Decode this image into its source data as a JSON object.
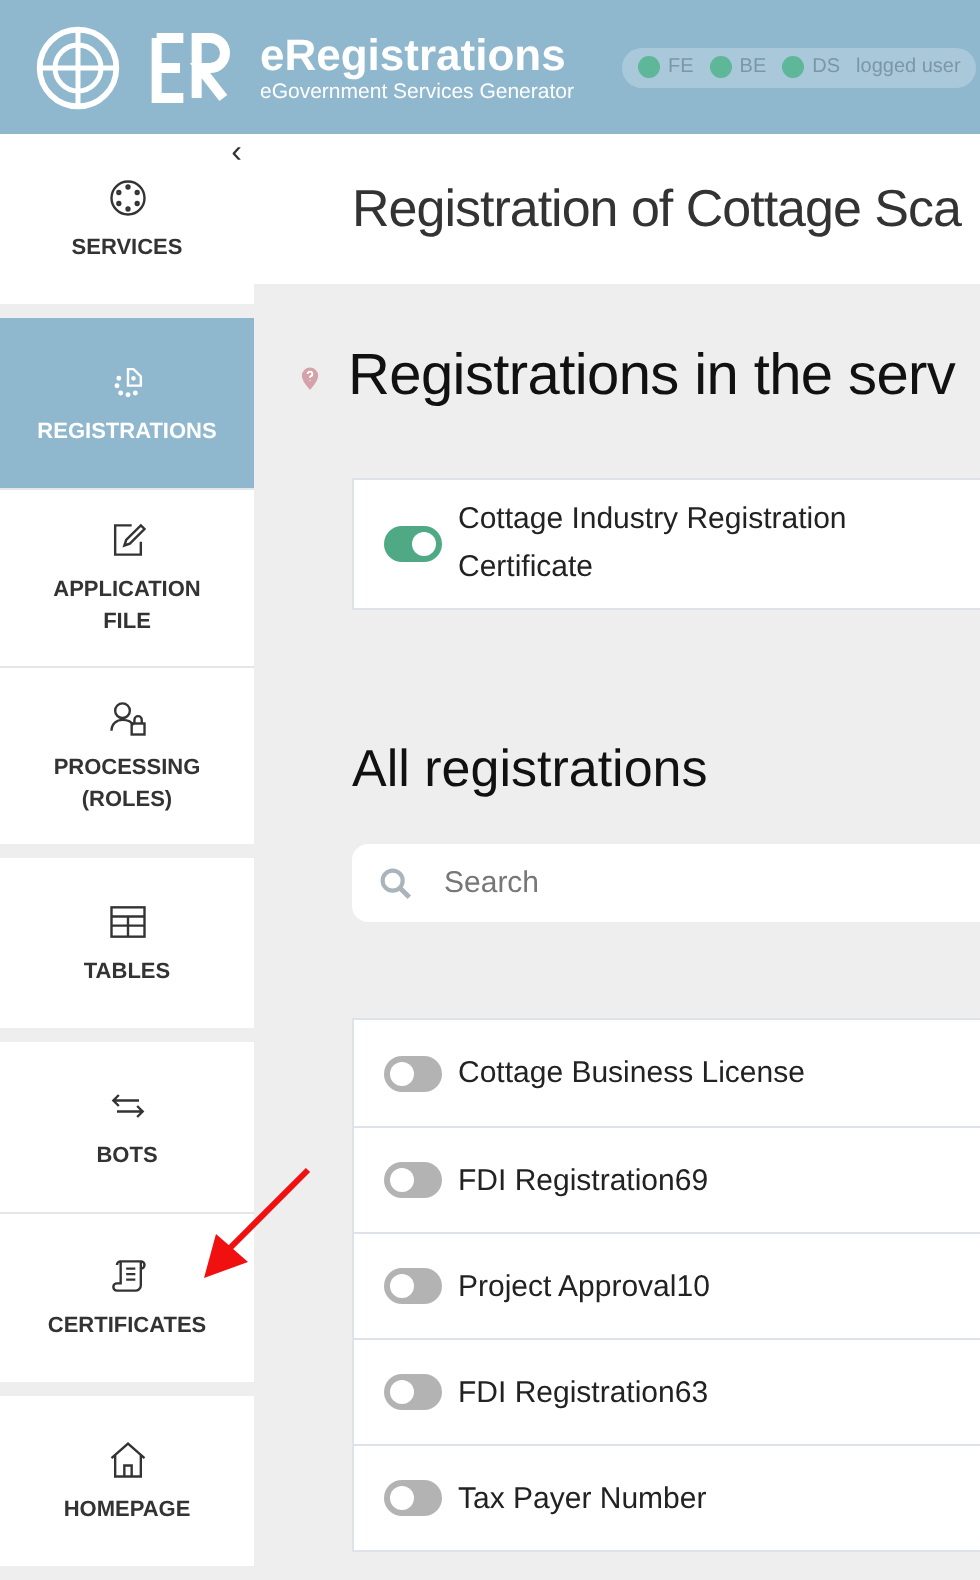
{
  "header": {
    "title": "eRegistrations",
    "subtitle": "eGovernment Services Generator",
    "status": [
      {
        "label": "FE",
        "color": "#5fb79a"
      },
      {
        "label": "BE",
        "color": "#5fb79a"
      },
      {
        "label": "DS",
        "color": "#5fb79a"
      }
    ],
    "logged_users": "logged user"
  },
  "sidebar": {
    "collapse": "‹",
    "groups": [
      {
        "items": [
          {
            "label": "SERVICES",
            "kind": "services",
            "selected": false
          }
        ]
      },
      {
        "items": [
          {
            "label": "REGISTRATIONS",
            "kind": "registrations",
            "selected": true
          },
          {
            "label": "APPLICATION FILE",
            "kind": "file",
            "selected": false
          },
          {
            "label": "PROCESSING (ROLES)",
            "kind": "roles",
            "selected": false
          }
        ]
      },
      {
        "items": [
          {
            "label": "TABLES",
            "kind": "tables",
            "selected": false
          }
        ]
      },
      {
        "items": [
          {
            "label": "BOTS",
            "kind": "bots",
            "selected": false
          },
          {
            "label": "CERTIFICATES",
            "kind": "certificates",
            "selected": false
          }
        ]
      },
      {
        "items": [
          {
            "label": "HOMEPAGE",
            "kind": "home",
            "selected": false
          }
        ]
      }
    ]
  },
  "page_title": "Registration of Cottage Sca",
  "section_heading": "Registrations in the serv",
  "service_registrations": [
    {
      "label": "Cottage Industry Registration Certificate",
      "on": true
    }
  ],
  "all_heading": "All registrations",
  "search": {
    "placeholder": "Search"
  },
  "registrations": [
    {
      "label": "Cottage Business License",
      "on": false
    },
    {
      "label": "FDI Registration69",
      "on": false
    },
    {
      "label": "Project Approval10",
      "on": false
    },
    {
      "label": "FDI Registration63",
      "on": false
    },
    {
      "label": "Tax Payer Number",
      "on": false
    }
  ]
}
